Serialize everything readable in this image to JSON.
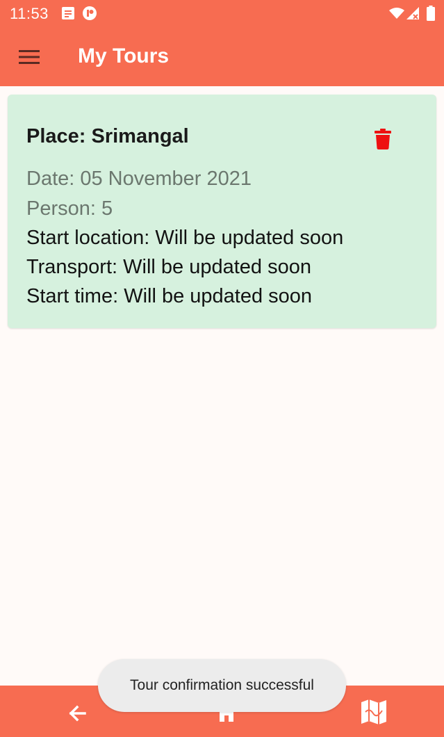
{
  "status_bar": {
    "time": "11:53",
    "icons": [
      "notes-icon",
      "app-notification-icon",
      "wifi-icon",
      "signal-icon",
      "battery-icon"
    ]
  },
  "app_bar": {
    "title": "My Tours",
    "menu_icon": "hamburger-menu-icon"
  },
  "tour": {
    "place": "Place: Srimangal",
    "date": "Date: 05 November 2021",
    "person": "Person: 5",
    "start_location": "Start location: Will be updated soon",
    "transport": "Transport: Will be updated soon",
    "start_time": "Start time: Will be updated soon",
    "delete_icon": "trash-icon"
  },
  "bottom_nav": {
    "items": [
      "back-arrow-icon",
      "home-icon",
      "map-icon"
    ]
  },
  "toast": {
    "message": "Tour confirmation successful"
  },
  "colors": {
    "primary": "#f76c51",
    "card_background": "#d6f1de",
    "delete_red": "#ee1111",
    "muted_text": "#6b776e"
  }
}
